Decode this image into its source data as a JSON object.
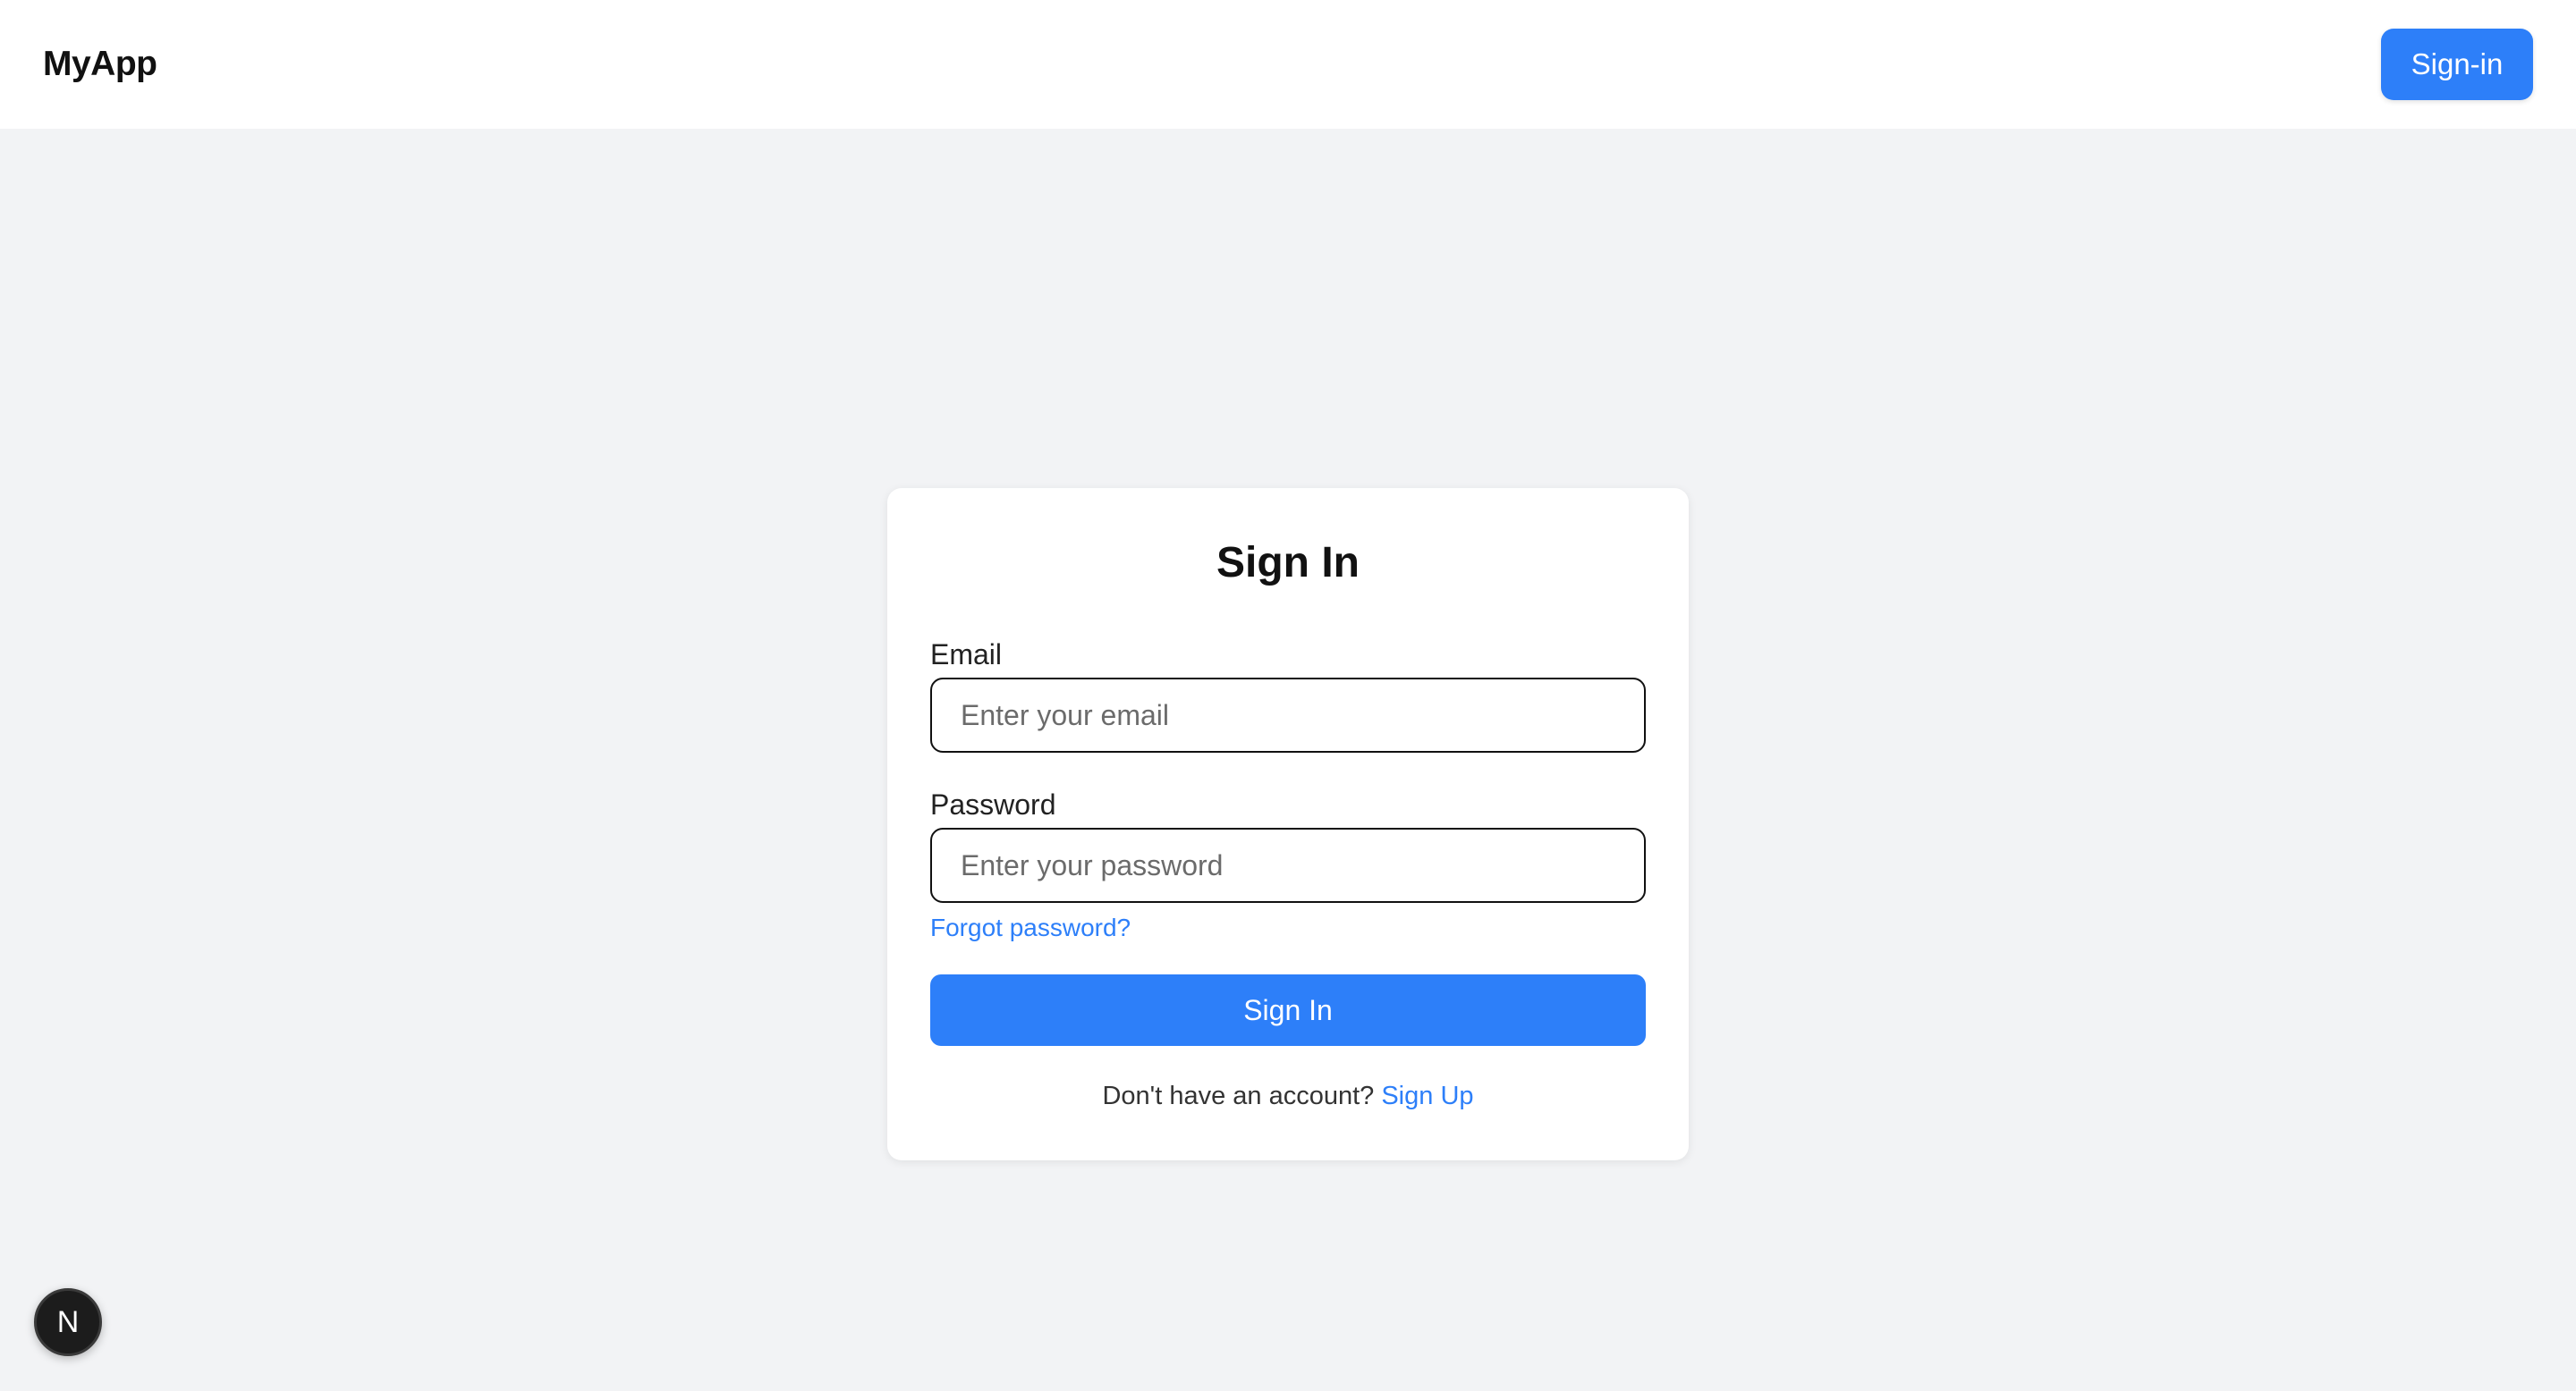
{
  "navbar": {
    "brand": "MyApp",
    "signin_label": "Sign-in"
  },
  "signin_card": {
    "title": "Sign In",
    "email_label": "Email",
    "email_placeholder": "Enter your email",
    "email_value": "",
    "password_label": "Password",
    "password_placeholder": "Enter your password",
    "password_value": "",
    "forgot_label": "Forgot password?",
    "submit_label": "Sign In",
    "signup_prompt": "Don't have an account?",
    "signup_label": "Sign Up"
  },
  "dev_badge": {
    "letter": "N",
    "icon": "nextjs-logo-icon"
  },
  "colors": {
    "accent": "#2d7ff9",
    "page_background": "#f2f3f5",
    "card_background": "#ffffff",
    "badge_background": "#1c1c1c"
  }
}
